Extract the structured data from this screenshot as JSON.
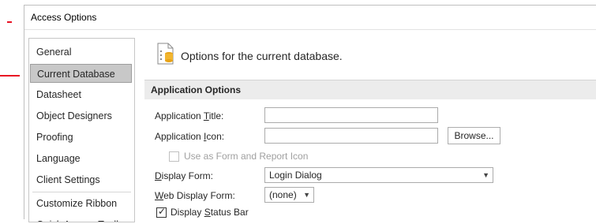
{
  "window": {
    "title": "Access Options"
  },
  "nav": {
    "items": [
      {
        "label": "General",
        "selected": false
      },
      {
        "label": "Current Database",
        "selected": true
      },
      {
        "label": "Datasheet",
        "selected": false
      },
      {
        "label": "Object Designers",
        "selected": false
      },
      {
        "label": "Proofing",
        "selected": false
      },
      {
        "label": "Language",
        "selected": false
      },
      {
        "label": "Client Settings",
        "selected": false
      },
      {
        "label": "Customize Ribbon",
        "selected": false
      },
      {
        "label": "Quick Access Toolbar",
        "selected": false
      }
    ]
  },
  "content": {
    "header_text": "Options for the current database.",
    "header_icon": "database-options-icon",
    "section_title": "Application Options",
    "fields": {
      "app_title": {
        "label_pre": "Application ",
        "label_key": "T",
        "label_post": "itle:",
        "value": ""
      },
      "app_icon": {
        "label_pre": "Application ",
        "label_key": "I",
        "label_post": "con:",
        "value": "",
        "browse_label": "Browse..."
      },
      "use_as_form_icon": {
        "label": "Use as Form and Report Icon",
        "checked": false,
        "enabled": false
      },
      "display_form": {
        "label_pre": "",
        "label_key": "D",
        "label_post": "isplay Form:",
        "value": "Login Dialog"
      },
      "web_display_form": {
        "label_pre": "",
        "label_key": "W",
        "label_post": "eb Display Form:",
        "value": "(none)"
      },
      "display_status_bar": {
        "label_pre": "Display ",
        "label_key": "S",
        "label_post": "tatus Bar",
        "checked": true
      }
    }
  },
  "colors": {
    "annotation_red": "#e81123",
    "selected_nav": "#c8c8c8",
    "section_bar": "#ececec"
  }
}
